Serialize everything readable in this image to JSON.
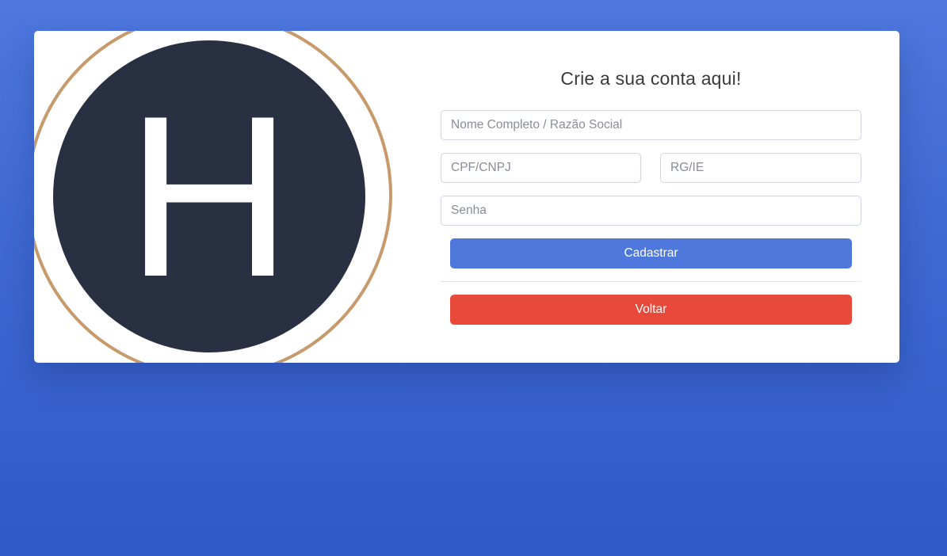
{
  "logo": {
    "letter": "H",
    "circle_color": "#293042",
    "ring_color": "#c79a6c",
    "letter_color": "#ffffff"
  },
  "form": {
    "title": "Crie a sua conta aqui!",
    "nome": {
      "placeholder": "Nome Completo / Razão Social",
      "value": ""
    },
    "cpf": {
      "placeholder": "CPF/CNPJ",
      "value": ""
    },
    "rg": {
      "placeholder": "RG/IE",
      "value": ""
    },
    "senha": {
      "placeholder": "Senha",
      "value": ""
    },
    "submit_label": "Cadastrar",
    "back_label": "Voltar"
  },
  "colors": {
    "background": "#4573d8",
    "primary": "#4e78dc",
    "danger": "#e74a3b"
  }
}
